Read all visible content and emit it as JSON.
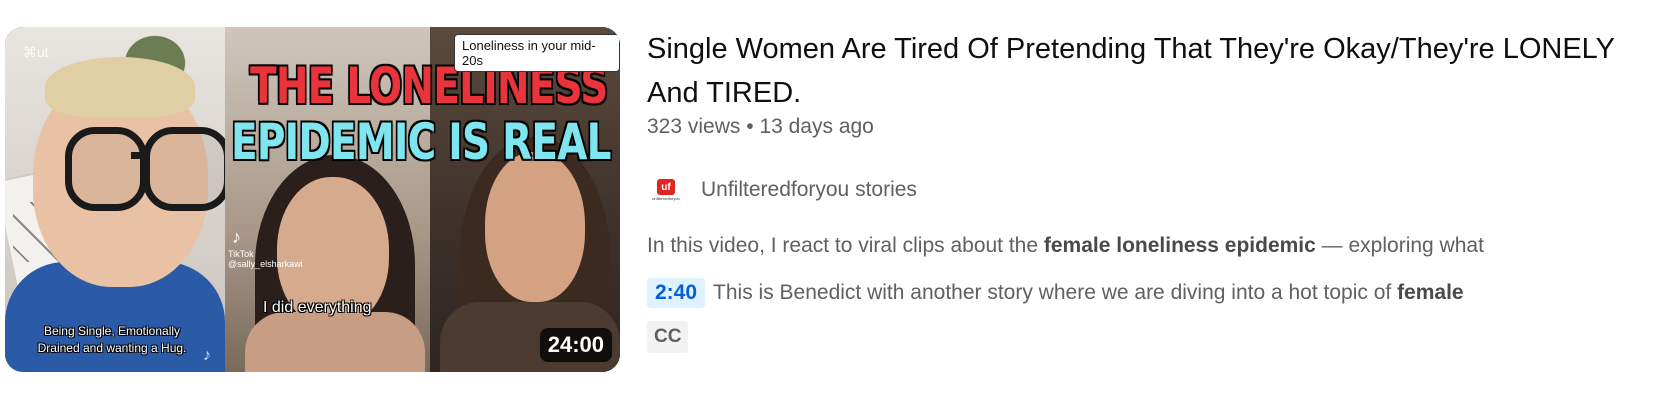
{
  "video": {
    "title": "Single Women Are Tired Of Pretending That They're Okay/They're LONELY And TIRED.",
    "views": "323 views",
    "separator": "•",
    "age": "13 days ago",
    "duration": "24:00",
    "channel": {
      "name": "Unfilteredforyou stories",
      "avatar_logo_text": "uf",
      "avatar_subtext": "unfilteredforyou"
    },
    "description": {
      "prefix": "In this video, I react to viral clips about the ",
      "bold": "female loneliness epidemic",
      "suffix": " — exploring what"
    },
    "chapter": {
      "timestamp": "2:40",
      "text_prefix": "This is Benedict with another story where we are diving into a hot topic of ",
      "text_bold": "female"
    },
    "badge": "CC"
  },
  "thumbnail": {
    "headline_line1": "THE LONELINESS",
    "headline_line2": "EPIDEMIC IS REAL",
    "corner_label": "Loneliness in your mid-20s",
    "caption_left": "Being Single, Emotionally Drained and wanting a Hug.",
    "caption_middle": "I did everything",
    "capcut_mark": "⌘ut",
    "tiktok_label": "TikTok",
    "tiktok_handle": "@sally_elsharkawi"
  },
  "colors": {
    "headline_red": "#e8343a",
    "headline_cyan": "#7fe6ef",
    "timestamp_bg": "#def1ff",
    "timestamp_fg": "#065fd4",
    "meta_gray": "#606060"
  }
}
